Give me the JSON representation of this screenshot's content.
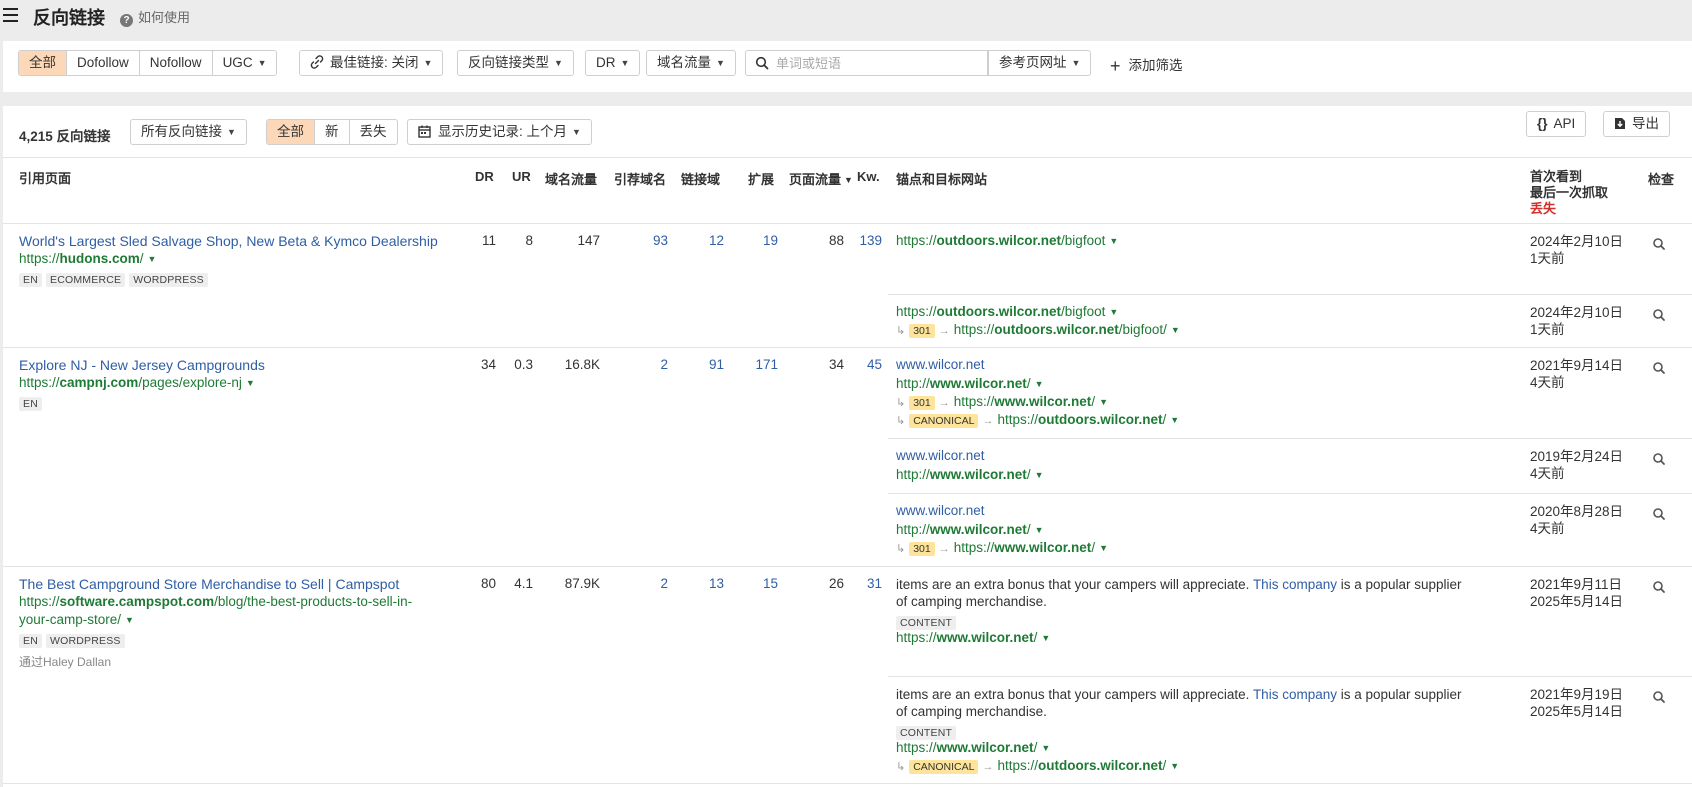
{
  "header": {
    "title": "反向链接",
    "help": "如何使用"
  },
  "filters": {
    "type_all": "全部",
    "dofollow": "Dofollow",
    "nofollow": "Nofollow",
    "ugc": "UGC",
    "best_links": "最佳链接: 关闭",
    "link_type": "反向链接类型",
    "dr": "DR",
    "domain_traffic": "域名流量",
    "search_placeholder": "单词或短语",
    "ref_page_url": "参考页网址",
    "add_filter": "添加筛选"
  },
  "toolbar": {
    "count": "4,215 反向链接",
    "all_backlinks": "所有反向链接",
    "tab_all": "全部",
    "tab_new": "新",
    "tab_lost": "丢失",
    "history": "显示历史记录: 上个月",
    "api": "API",
    "export": "导出"
  },
  "columns": {
    "referring_page": "引用页面",
    "dr": "DR",
    "ur": "UR",
    "domain_traffic": "域名流量",
    "ref_domains": "引荐域名",
    "linked_domains": "链接域",
    "ext": "扩展",
    "page_traffic": "页面流量",
    "kw": "Kw.",
    "anchor": "锚点和目标网站",
    "first_seen": "首次看到",
    "last_crawled": "最后一次抓取",
    "lost": "丢失",
    "inspect": "检查"
  },
  "rows": [
    {
      "title": "World's Largest Sled Salvage Shop, New Beta & Kymco Dealership",
      "url_pre": "https://",
      "url_bold": "hudons.com",
      "url_post": "/",
      "tags": [
        "EN",
        "ECOMMERCE",
        "WORDPRESS"
      ],
      "dr": "11",
      "ur": "8",
      "domain_traffic": "147",
      "ref_domains": "93",
      "linked_domains": "12",
      "ext": "19",
      "page_traffic": "88",
      "kw": "139",
      "links": [
        {
          "target_pre": "https://",
          "target_bold": "outdoors.wilcor.net",
          "target_post": "/bigfoot",
          "first": "2024年2月10日",
          "last": "1天前"
        },
        {
          "target_pre": "https://",
          "target_bold": "outdoors.wilcor.net",
          "target_post": "/bigfoot",
          "redirect_code": "301",
          "redirect_pre": "https://",
          "redirect_bold": "outdoors.wilcor.net",
          "redirect_post": "/bigfoot/",
          "first": "2024年2月10日",
          "last": "1天前"
        }
      ]
    },
    {
      "title": "Explore NJ - New Jersey Campgrounds",
      "url_pre": "https://",
      "url_bold": "campnj.com",
      "url_post": "/pages/explore-nj",
      "tags": [
        "EN"
      ],
      "dr": "34",
      "ur": "0.3",
      "domain_traffic": "16.8K",
      "ref_domains": "2",
      "linked_domains": "91",
      "ext": "171",
      "page_traffic": "34",
      "kw": "45",
      "links": [
        {
          "anchor": "www.wilcor.net",
          "target_pre": "http://",
          "target_bold": "www.wilcor.net",
          "target_post": "/",
          "redirect_code": "301",
          "redirect_pre": "https://",
          "redirect_bold": "www.wilcor.net",
          "redirect_post": "/",
          "canonical": "CANONICAL",
          "canonical_pre": "https://",
          "canonical_bold": "outdoors.wilcor.net",
          "canonical_post": "/",
          "first": "2021年9月14日",
          "last": "4天前"
        },
        {
          "anchor": "www.wilcor.net",
          "target_pre": "http://",
          "target_bold": "www.wilcor.net",
          "target_post": "/",
          "first": "2019年2月24日",
          "last": "4天前"
        },
        {
          "anchor": "www.wilcor.net",
          "target_pre": "http://",
          "target_bold": "www.wilcor.net",
          "target_post": "/",
          "redirect_code": "301",
          "redirect_pre": "https://",
          "redirect_bold": "www.wilcor.net",
          "redirect_post": "/",
          "first": "2020年8月28日",
          "last": "4天前"
        }
      ]
    },
    {
      "title": "The Best Campground Store Merchandise to Sell | Campspot",
      "url_pre": "https://",
      "url_bold": "software.campspot.com",
      "url_post": "/blog/the-best-products-to-sell-in-",
      "url_post2": "your-camp-store/",
      "tags": [
        "EN",
        "WORDPRESS"
      ],
      "via": "通过Haley Dallan",
      "dr": "80",
      "ur": "4.1",
      "domain_traffic": "87.9K",
      "ref_domains": "2",
      "linked_domains": "13",
      "ext": "15",
      "page_traffic": "26",
      "kw": "31",
      "links": [
        {
          "text_before": "items are an extra bonus that your campers will appreciate. ",
          "anchor": "This company",
          "text_after": " is a popular supplier of camping merchandise.",
          "tag": "CONTENT",
          "target_pre": "https://",
          "target_bold": "www.wilcor.net",
          "target_post": "/",
          "first": "2021年9月11日",
          "last": "2025年5月14日"
        },
        {
          "text_before": "items are an extra bonus that your campers will appreciate. ",
          "anchor": "This company",
          "text_after": " is a popular supplier of camping merchandise.",
          "tag": "CONTENT",
          "target_pre": "https://",
          "target_bold": "www.wilcor.net",
          "target_post": "/",
          "canonical": "CANONICAL",
          "canonical_pre": "https://",
          "canonical_bold": "outdoors.wilcor.net",
          "canonical_post": "/",
          "first": "2021年9月19日",
          "last": "2025年5月14日"
        }
      ]
    }
  ]
}
